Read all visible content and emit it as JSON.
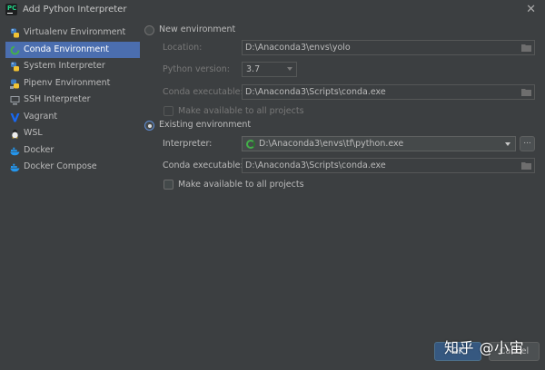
{
  "window": {
    "title": "Add Python Interpreter",
    "close_glyph": "✕"
  },
  "sidebar": {
    "items": [
      {
        "label": "Virtualenv Environment",
        "icon": "python-icon"
      },
      {
        "label": "Conda Environment",
        "icon": "conda-icon",
        "selected": true
      },
      {
        "label": "System Interpreter",
        "icon": "python-icon"
      },
      {
        "label": "Pipenv Environment",
        "icon": "pipenv-icon"
      },
      {
        "label": "SSH Interpreter",
        "icon": "ssh-icon"
      },
      {
        "label": "Vagrant",
        "icon": "vagrant-icon"
      },
      {
        "label": "WSL",
        "icon": "linux-icon"
      },
      {
        "label": "Docker",
        "icon": "docker-icon"
      },
      {
        "label": "Docker Compose",
        "icon": "docker-icon"
      }
    ]
  },
  "new_env": {
    "radio_label": "New environment",
    "selected": false,
    "location_label": "Location:",
    "location_value": "D:\\Anaconda3\\envs\\yolo",
    "python_version_label": "Python version:",
    "python_version_value": "3.7",
    "conda_exe_label": "Conda executable:",
    "conda_exe_value": "D:\\Anaconda3\\Scripts\\conda.exe",
    "make_available_label": "Make available to all projects"
  },
  "existing_env": {
    "radio_label": "Existing environment",
    "selected": true,
    "interpreter_label": "Interpreter:",
    "interpreter_value": "D:\\Anaconda3\\envs\\tf\\python.exe",
    "browse_label": "...",
    "conda_exe_label": "Conda executable:",
    "conda_exe_value": "D:\\Anaconda3\\Scripts\\conda.exe",
    "make_available_label": "Make available to all projects"
  },
  "footer": {
    "ok_label": "OK",
    "cancel_label": "Cancel"
  },
  "watermark": {
    "text": "知乎 @小宙"
  },
  "colors": {
    "accent": "#4b6eaf",
    "background": "#3c3f41",
    "ok_button": "#365880"
  }
}
